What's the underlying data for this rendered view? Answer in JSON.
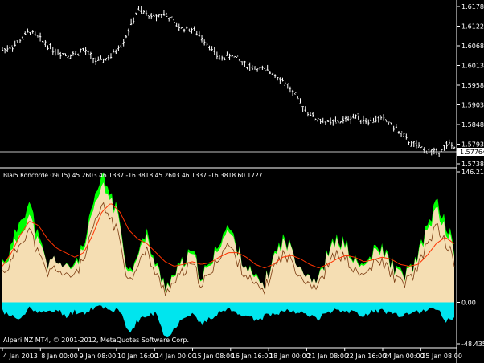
{
  "price_chart": {
    "y_ticks": [
      "1.61780",
      "1.61225",
      "1.60680",
      "1.60130",
      "1.59585",
      "1.59035",
      "1.58480",
      "1.57935",
      "1.57385"
    ],
    "current_price": "1.57764"
  },
  "indicator": {
    "title": "Blai5 Koncorde 09(15) 45.2603 46.1337 -16.3818 45.2603 46.1337 -16.3818 60.1727",
    "y_ticks": [
      "146.2108",
      "0.00",
      "-48.4353"
    ]
  },
  "x_axis": {
    "labels": [
      "4 Jan 2013",
      "8 Jan 00:00",
      "9 Jan 08:00",
      "10 Jan 16:00",
      "14 Jan 00:00",
      "15 Jan 08:00",
      "16 Jan 16:00",
      "18 Jan 00:00",
      "21 Jan 08:00",
      "22 Jan 16:00",
      "24 Jan 00:00",
      "25 Jan 08:00"
    ]
  },
  "footer": {
    "copyright": "Alpari NZ MT4, © 2001-2012, MetaQuotes Software Corp."
  },
  "colors": {
    "background": "#000000",
    "foreground": "#ffffff",
    "bid_line": "#c0c0c0",
    "fill_green": "#00ff00",
    "fill_beige": "#f5deb3",
    "fill_cyan": "#00e5ee",
    "line_red": "#ff3300",
    "line_brown": "#7a3a10"
  },
  "chart_data": [
    {
      "type": "line",
      "title": "",
      "ylim": [
        1.5725,
        1.6185
      ],
      "x": [
        0,
        0.03,
        0.06,
        0.09,
        0.12,
        0.15,
        0.18,
        0.21,
        0.24,
        0.27,
        0.3,
        0.33,
        0.36,
        0.39,
        0.42,
        0.45,
        0.48,
        0.51,
        0.54,
        0.57,
        0.6,
        0.63,
        0.66,
        0.69,
        0.72,
        0.75,
        0.78,
        0.81,
        0.84,
        0.87,
        0.9,
        0.93,
        0.96,
        0.99,
        1.0
      ],
      "values": [
        1.6055,
        1.607,
        1.611,
        1.608,
        1.605,
        1.604,
        1.6055,
        1.602,
        1.6035,
        1.6085,
        1.617,
        1.615,
        1.616,
        1.612,
        1.6115,
        1.608,
        1.603,
        1.604,
        1.601,
        1.6,
        1.599,
        1.5955,
        1.59,
        1.586,
        1.5845,
        1.585,
        1.5865,
        1.585,
        1.586,
        1.583,
        1.579,
        1.577,
        1.576,
        1.5785,
        1.5776
      ]
    },
    {
      "type": "area",
      "title": "Blai5 Koncorde 09(15)",
      "ylim": [
        -48.4353,
        146.2108
      ],
      "x": [
        0,
        0.02,
        0.04,
        0.06,
        0.08,
        0.1,
        0.12,
        0.14,
        0.16,
        0.18,
        0.2,
        0.22,
        0.24,
        0.26,
        0.28,
        0.3,
        0.32,
        0.34,
        0.36,
        0.38,
        0.4,
        0.42,
        0.44,
        0.46,
        0.48,
        0.5,
        0.52,
        0.54,
        0.56,
        0.58,
        0.6,
        0.62,
        0.64,
        0.66,
        0.68,
        0.7,
        0.72,
        0.74,
        0.76,
        0.78,
        0.8,
        0.82,
        0.84,
        0.86,
        0.88,
        0.9,
        0.92,
        0.94,
        0.96,
        0.98,
        1.0
      ],
      "series": [
        {
          "values": [
            45,
            60,
            95,
            110,
            70,
            40,
            50,
            35,
            45,
            60,
            105,
            140,
            120,
            90,
            30,
            60,
            75,
            40,
            20,
            30,
            45,
            55,
            30,
            40,
            70,
            85,
            60,
            40,
            25,
            20,
            50,
            70,
            60,
            40,
            30,
            25,
            55,
            70,
            65,
            45,
            40,
            55,
            60,
            45,
            30,
            35,
            50,
            85,
            110,
            90,
            60
          ]
        },
        {
          "values": [
            10,
            5,
            -5,
            20,
            15,
            25,
            35,
            10,
            5,
            15,
            45,
            60,
            70,
            50,
            -10,
            20,
            25,
            5,
            -15,
            -5,
            10,
            15,
            -5,
            5,
            20,
            35,
            25,
            10,
            -10,
            -5,
            15,
            25,
            30,
            10,
            0,
            -5,
            20,
            30,
            25,
            10,
            5,
            15,
            20,
            10,
            -5,
            0,
            15,
            35,
            45,
            30,
            20
          ]
        },
        {
          "values": [
            -10,
            -15,
            -20,
            -5,
            -10,
            -12,
            -8,
            -15,
            -10,
            -12,
            -6,
            -4,
            -8,
            -10,
            -35,
            -20,
            -15,
            -12,
            -40,
            -30,
            -15,
            -12,
            -25,
            -18,
            -10,
            -8,
            -12,
            -14,
            -20,
            -16,
            -12,
            -10,
            -8,
            -12,
            -15,
            -18,
            -10,
            -8,
            -9,
            -12,
            -14,
            -10,
            -9,
            -12,
            -16,
            -14,
            -10,
            -8,
            -6,
            -20,
            -16
          ]
        },
        {
          "values": [
            40,
            55,
            75,
            90,
            85,
            70,
            60,
            55,
            50,
            55,
            75,
            100,
            110,
            100,
            80,
            70,
            65,
            55,
            45,
            40,
            42,
            45,
            42,
            44,
            50,
            55,
            55,
            50,
            42,
            38,
            42,
            50,
            52,
            48,
            42,
            38,
            42,
            48,
            52,
            50,
            45,
            47,
            50,
            48,
            42,
            40,
            42,
            52,
            65,
            72,
            65
          ]
        }
      ]
    }
  ]
}
